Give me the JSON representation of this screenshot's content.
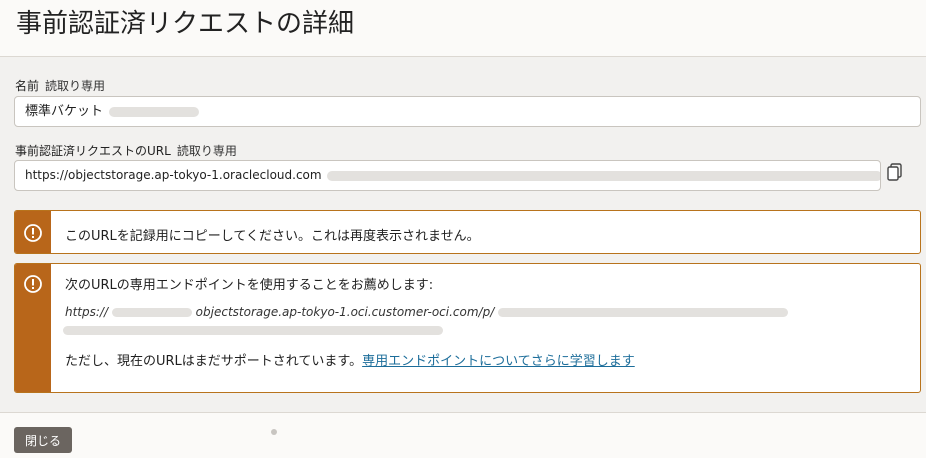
{
  "header": {
    "title": "事前認証済リクエストの詳細"
  },
  "name_field": {
    "label": "名前",
    "readonly": "読取り専用",
    "value": "標準バケット"
  },
  "url_field": {
    "label": "事前認証済リクエストのURL",
    "readonly": "読取り専用",
    "value": "https://objectstorage.ap-tokyo-1.oraclecloud.com"
  },
  "alert_copy": {
    "text": "このURLを記録用にコピーしてください。これは再度表示されません。"
  },
  "alert_endpoint": {
    "intro": "次のURLの専用エンドポイントを使用することをお薦めします:",
    "url_prefix": "https://",
    "url_domain": "objectstorage.ap-tokyo-1.oci.customer-oci.com/p/",
    "note": "ただし、現在のURLはまだサポートされています。",
    "link": "専用エンドポイントについてさらに学習します"
  },
  "footer": {
    "close_label": "閉じる"
  },
  "colors": {
    "accent": "#b8661a",
    "link": "#1c6d9a",
    "button": "#6b6560"
  },
  "icons": {
    "copy": "copy-icon",
    "warning": "warning-circle-icon"
  }
}
